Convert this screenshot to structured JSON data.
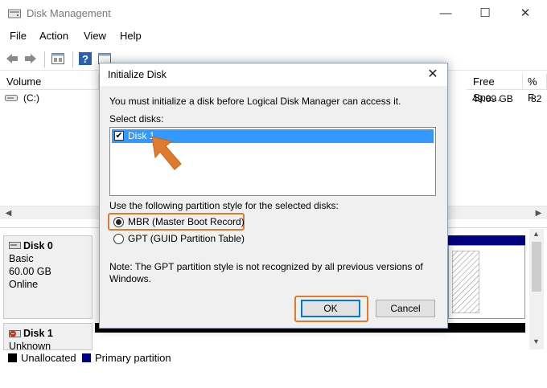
{
  "window": {
    "title": "Disk Management",
    "minimize": "—",
    "maximize": "☐",
    "close": "✕"
  },
  "menu": [
    "File",
    "Action",
    "View",
    "Help"
  ],
  "volume_list": {
    "headers": [
      "Volume",
      "Free Spa...",
      "% F"
    ],
    "rows": [
      {
        "volume": "(C:)",
        "free_space": "49.09 GB",
        "percent_free": "82"
      }
    ]
  },
  "disks": [
    {
      "name": "Disk 0",
      "type": "Basic",
      "size": "60.00 GB",
      "status": "Online"
    },
    {
      "name": "Disk 1",
      "status": "Unknown"
    }
  ],
  "legend": [
    {
      "label": "Unallocated",
      "color": "#000000"
    },
    {
      "label": "Primary partition",
      "color": "#000080"
    }
  ],
  "dialog": {
    "title": "Initialize Disk",
    "close": "✕",
    "intro": "You must initialize a disk before Logical Disk Manager can access it.",
    "select_label": "Select disks:",
    "disk_items": [
      {
        "label": "Disk 1",
        "checked": true
      }
    ],
    "partition_prompt": "Use the following partition style for the selected disks:",
    "options": [
      {
        "label": "MBR (Master Boot Record)",
        "selected": true
      },
      {
        "label": "GPT (GUID Partition Table)",
        "selected": false
      }
    ],
    "note_line1": "Note: The GPT partition style is not recognized by all previous versions of",
    "note_line2": "Windows.",
    "ok_label": "OK",
    "cancel_label": "Cancel"
  },
  "colors": {
    "accent_highlight": "#e07b2e",
    "selection": "#3399ff",
    "primary_partition": "#000080"
  }
}
